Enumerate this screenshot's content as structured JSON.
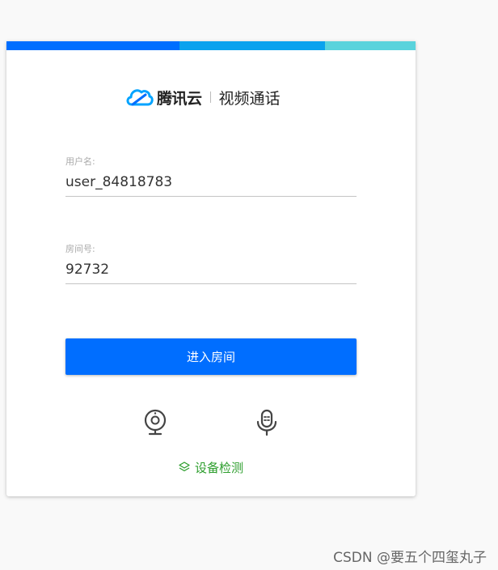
{
  "header": {
    "brand": "腾讯云",
    "product": "视频通话",
    "logo_icon": "tencent-cloud-logo-icon"
  },
  "form": {
    "username_label": "用户名:",
    "username_value": "user_84818783",
    "room_label": "房间号:",
    "room_value": "92732",
    "enter_label": "进入房间"
  },
  "devices": {
    "camera_icon": "camera-icon",
    "mic_icon": "microphone-icon",
    "detect_label": "设备检测",
    "detect_icon": "layers-icon"
  },
  "watermark": "CSDN @要五个四玺丸子",
  "colors": {
    "bar1": "#006eff",
    "bar2": "#0aa2ee",
    "bar3": "#59d3dc",
    "primary": "#006eff",
    "detect": "#2d9e2d"
  }
}
